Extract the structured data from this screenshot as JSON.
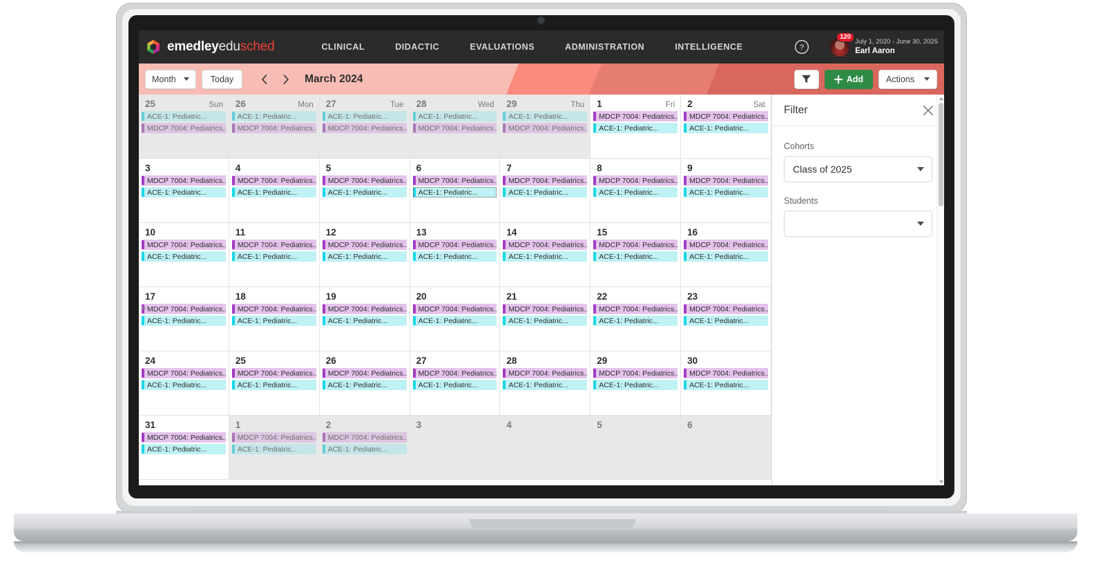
{
  "header": {
    "brand": {
      "part1": "emedley",
      "part2": "edu",
      "part3": "sched"
    },
    "nav": [
      {
        "label": "CLINICAL"
      },
      {
        "label": "DIDACTIC"
      },
      {
        "label": "EVALUATIONS"
      },
      {
        "label": "ADMINISTRATION"
      },
      {
        "label": "INTELLIGENCE"
      }
    ],
    "help_icon": "question-circle-icon",
    "badge_count": "120",
    "date_range": "July 1, 2020 - June 30, 2025",
    "user_name": "Earl Aaron"
  },
  "toolbar": {
    "view_label": "Month",
    "today_label": "Today",
    "prev_icon": "chevron-left-icon",
    "next_icon": "chevron-right-icon",
    "period_title": "March 2024",
    "filter_icon": "funnel-icon",
    "add_label": "Add",
    "add_icon": "plus-icon",
    "actions_label": "Actions"
  },
  "calendar": {
    "event_titles": {
      "mdcp": "MDCP 7004: Pediatrics...",
      "ace": "ACE-1: Pediatric..."
    },
    "weekday_names": [
      "Sun",
      "Mon",
      "Tue",
      "Wed",
      "Thu",
      "Fri",
      "Sat"
    ],
    "collapse_icon": "chevrons-right-icon",
    "weeks": [
      [
        {
          "num": "25",
          "dayname": "Sun",
          "other": true,
          "events": [
            "ace",
            "mdcp"
          ]
        },
        {
          "num": "26",
          "dayname": "Mon",
          "other": true,
          "events": [
            "ace",
            "mdcp"
          ]
        },
        {
          "num": "27",
          "dayname": "Tue",
          "other": true,
          "events": [
            "ace",
            "mdcp"
          ]
        },
        {
          "num": "28",
          "dayname": "Wed",
          "other": true,
          "events": [
            "ace",
            "mdcp"
          ]
        },
        {
          "num": "29",
          "dayname": "Thu",
          "other": true,
          "events": [
            "ace",
            "mdcp"
          ]
        },
        {
          "num": "1",
          "dayname": "Fri",
          "other": false,
          "events": [
            "mdcp",
            "ace"
          ]
        },
        {
          "num": "2",
          "dayname": "Sat",
          "other": false,
          "events": [
            "mdcp",
            "ace"
          ]
        }
      ],
      [
        {
          "num": "3",
          "other": false,
          "events": [
            "mdcp",
            "ace"
          ]
        },
        {
          "num": "4",
          "other": false,
          "events": [
            "mdcp",
            "ace"
          ]
        },
        {
          "num": "5",
          "other": false,
          "events": [
            "mdcp",
            "ace"
          ]
        },
        {
          "num": "6",
          "other": false,
          "events": [
            "mdcp",
            "ace"
          ],
          "focused": 1
        },
        {
          "num": "7",
          "other": false,
          "events": [
            "mdcp",
            "ace"
          ]
        },
        {
          "num": "8",
          "other": false,
          "events": [
            "mdcp",
            "ace"
          ]
        },
        {
          "num": "9",
          "other": false,
          "events": [
            "mdcp",
            "ace"
          ]
        }
      ],
      [
        {
          "num": "10",
          "other": false,
          "events": [
            "mdcp",
            "ace"
          ]
        },
        {
          "num": "11",
          "other": false,
          "events": [
            "mdcp",
            "ace"
          ]
        },
        {
          "num": "12",
          "other": false,
          "events": [
            "mdcp",
            "ace"
          ]
        },
        {
          "num": "13",
          "other": false,
          "events": [
            "mdcp",
            "ace"
          ]
        },
        {
          "num": "14",
          "other": false,
          "events": [
            "mdcp",
            "ace"
          ]
        },
        {
          "num": "15",
          "other": false,
          "events": [
            "mdcp",
            "ace"
          ]
        },
        {
          "num": "16",
          "other": false,
          "events": [
            "mdcp",
            "ace"
          ]
        }
      ],
      [
        {
          "num": "17",
          "other": false,
          "events": [
            "mdcp",
            "ace"
          ]
        },
        {
          "num": "18",
          "other": false,
          "events": [
            "mdcp",
            "ace"
          ]
        },
        {
          "num": "19",
          "other": false,
          "events": [
            "mdcp",
            "ace"
          ]
        },
        {
          "num": "20",
          "other": false,
          "events": [
            "mdcp",
            "ace"
          ]
        },
        {
          "num": "21",
          "other": false,
          "events": [
            "mdcp",
            "ace"
          ]
        },
        {
          "num": "22",
          "other": false,
          "events": [
            "mdcp",
            "ace"
          ]
        },
        {
          "num": "23",
          "other": false,
          "events": [
            "mdcp",
            "ace"
          ]
        }
      ],
      [
        {
          "num": "24",
          "other": false,
          "events": [
            "mdcp",
            "ace"
          ]
        },
        {
          "num": "25",
          "other": false,
          "events": [
            "mdcp",
            "ace"
          ]
        },
        {
          "num": "26",
          "other": false,
          "events": [
            "mdcp",
            "ace"
          ]
        },
        {
          "num": "27",
          "other": false,
          "events": [
            "mdcp",
            "ace"
          ]
        },
        {
          "num": "28",
          "other": false,
          "events": [
            "mdcp",
            "ace"
          ]
        },
        {
          "num": "29",
          "other": false,
          "events": [
            "mdcp",
            "ace"
          ]
        },
        {
          "num": "30",
          "other": false,
          "events": [
            "mdcp",
            "ace"
          ]
        }
      ],
      [
        {
          "num": "31",
          "other": false,
          "events": [
            "mdcp",
            "ace"
          ]
        },
        {
          "num": "1",
          "other": true,
          "events": [
            "mdcp",
            "ace"
          ]
        },
        {
          "num": "2",
          "other": true,
          "events": [
            "mdcp",
            "ace"
          ]
        },
        {
          "num": "3",
          "other": true,
          "events": []
        },
        {
          "num": "4",
          "other": true,
          "events": []
        },
        {
          "num": "5",
          "other": true,
          "events": []
        },
        {
          "num": "6",
          "other": true,
          "events": []
        }
      ]
    ]
  },
  "filter": {
    "title": "Filter",
    "close_icon": "close-icon",
    "cohorts_label": "Cohorts",
    "cohorts_value": "Class of 2025",
    "students_label": "Students",
    "students_value": ""
  },
  "colors": {
    "header_bg": "#2b2b2b",
    "brand_accent": "#ef4136",
    "toolbar_light": "#f9bcb5",
    "toolbar_mid": "#fa8a7e",
    "toolbar_dark": "#d9675e",
    "add_button": "#2e8b45",
    "badge": "#e8192c",
    "event_purple": "#a23cc4",
    "event_cyan": "#18d7e8"
  }
}
